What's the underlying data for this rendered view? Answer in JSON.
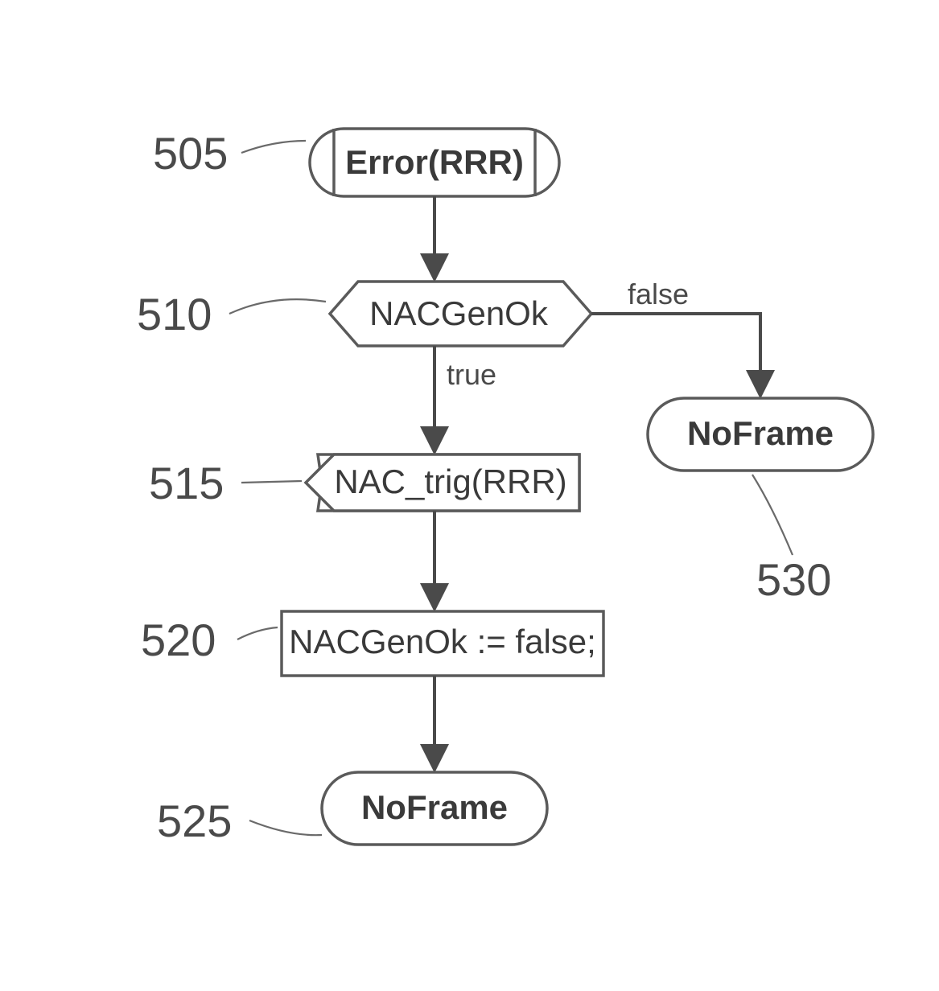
{
  "diagram": {
    "nodes": {
      "n505": {
        "ref": "505",
        "text": "Error(RRR)"
      },
      "n510": {
        "ref": "510",
        "text": "NACGenOk"
      },
      "n515": {
        "ref": "515",
        "text": "NAC_trig(RRR)"
      },
      "n520": {
        "ref": "520",
        "text": "NACGenOk := false;"
      },
      "n525": {
        "ref": "525",
        "text": "NoFrame"
      },
      "n530": {
        "ref": "530",
        "text": "NoFrame"
      }
    },
    "edges": {
      "true_label": "true",
      "false_label": "false"
    }
  }
}
